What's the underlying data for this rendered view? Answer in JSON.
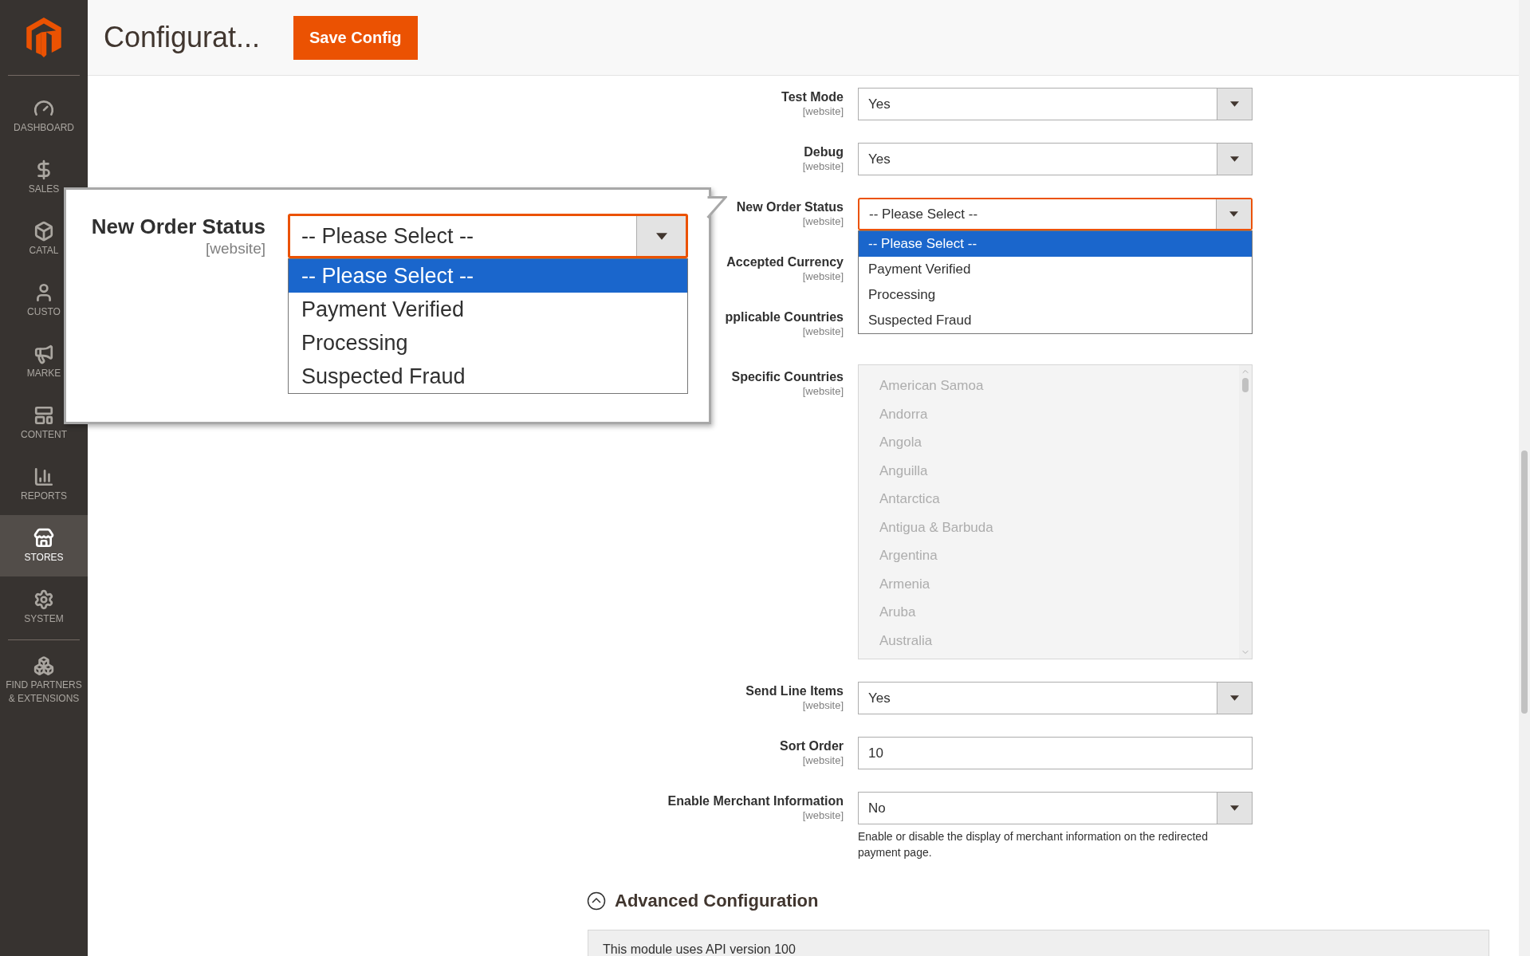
{
  "sidebar": {
    "items": [
      {
        "kind": "dashboard",
        "label": "DASHBOARD",
        "selected": false
      },
      {
        "kind": "sales",
        "label": "SALES",
        "selected": false
      },
      {
        "kind": "catalog",
        "label": "CATAL",
        "selected": false
      },
      {
        "kind": "customers",
        "label": "CUSTO",
        "selected": false
      },
      {
        "kind": "marketing",
        "label": "MARKE",
        "selected": false
      },
      {
        "kind": "content",
        "label": "CONTENT",
        "selected": false
      },
      {
        "kind": "reports",
        "label": "REPORTS",
        "selected": false
      },
      {
        "kind": "stores",
        "label": "STORES",
        "selected": true
      },
      {
        "kind": "system",
        "label": "SYSTEM",
        "selected": false
      },
      {
        "kind": "partners",
        "label": "FIND PARTNERS & EXTENSIONS",
        "selected": false
      }
    ]
  },
  "header": {
    "title": "Configurat...",
    "save_button": "Save Config"
  },
  "form": {
    "fields": [
      {
        "kind": "select",
        "label": "Test Mode",
        "scope": "[website]",
        "value": "Yes"
      },
      {
        "kind": "select",
        "label": "Debug",
        "scope": "[website]",
        "value": "Yes"
      },
      {
        "kind": "select",
        "label": "New Order Status",
        "scope": "[website]",
        "value": "-- Please Select --",
        "open": true,
        "options": [
          {
            "label": "-- Please Select --",
            "selected": true
          },
          {
            "label": "Payment Verified",
            "selected": false
          },
          {
            "label": "Processing",
            "selected": false
          },
          {
            "label": "Suspected Fraud",
            "selected": false
          }
        ]
      },
      {
        "kind": "covered",
        "label": "Accepted Currency",
        "scope": "[website]"
      },
      {
        "kind": "covered",
        "label": "pplicable Countries",
        "scope": "[website]"
      },
      {
        "kind": "multiselect",
        "label": "Specific Countries",
        "scope": "[website]",
        "disabled": true,
        "options": [
          "American Samoa",
          "Andorra",
          "Angola",
          "Anguilla",
          "Antarctica",
          "Antigua & Barbuda",
          "Argentina",
          "Armenia",
          "Aruba",
          "Australia"
        ]
      },
      {
        "kind": "select",
        "label": "Send Line Items",
        "scope": "[website]",
        "value": "Yes"
      },
      {
        "kind": "text",
        "label": "Sort Order",
        "scope": "[website]",
        "value": "10"
      },
      {
        "kind": "select",
        "label": "Enable Merchant Information",
        "scope": "[website]",
        "value": "No",
        "note": "Enable or disable the display of merchant information on the redirected payment page."
      }
    ]
  },
  "zoom_callout": {
    "label": "New Order Status",
    "scope": "[website]",
    "value": "-- Please Select --",
    "open": true,
    "options": [
      {
        "label": "-- Please Select --",
        "selected": true
      },
      {
        "label": "Payment Verified",
        "selected": false
      },
      {
        "label": "Processing",
        "selected": false
      },
      {
        "label": "Suspected Fraud",
        "selected": false
      }
    ]
  },
  "advanced": {
    "title": "Advanced Configuration",
    "expanded": true,
    "notice": "This module uses API version 100"
  }
}
